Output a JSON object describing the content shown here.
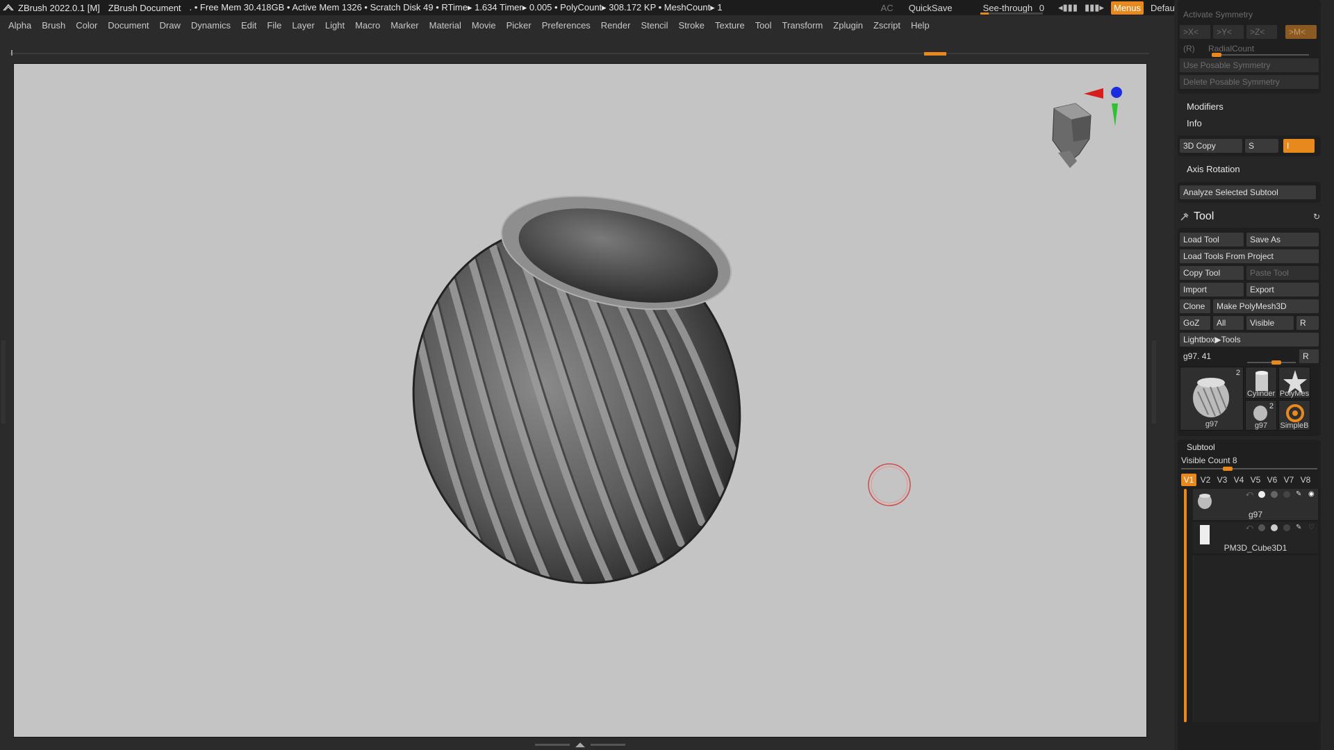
{
  "titlebar": {
    "app": "ZBrush 2022.0.1 [M]",
    "document": "ZBrush Document",
    "stats": ". • Free Mem 30.418GB • Active Mem 1326 • Scratch Disk 49 •  RTime▸ 1.634 Timer▸ 0.005 • PolyCount▸ 308.172 KP  • MeshCount▸ 1",
    "ac": "AC",
    "quicksave": "QuickSave",
    "see_through_label": "See-through",
    "see_through_value": "0",
    "menus": "Menus",
    "script": "DefaultZScript",
    "window_buttons": [
      "–",
      "□",
      "✕"
    ]
  },
  "menubar": [
    "Alpha",
    "Brush",
    "Color",
    "Document",
    "Draw",
    "Dynamics",
    "Edit",
    "File",
    "Layer",
    "Light",
    "Macro",
    "Marker",
    "Material",
    "Movie",
    "Picker",
    "Preferences",
    "Render",
    "Stencil",
    "Stroke",
    "Texture",
    "Tool",
    "Transform",
    "Zplugin",
    "Zscript",
    "Help"
  ],
  "symmetry": {
    "title": "Activate Symmetry",
    "x": ">X<",
    "y": ">Y<",
    "z": ">Z<",
    "m": ">M<",
    "r": "(R)",
    "radial": "RadialCount",
    "use_posable": "Use Posable Symmetry",
    "delete_posable": "Delete Posable Symmetry"
  },
  "geometry_tail": {
    "modifiers": "Modifiers",
    "info": "Info",
    "copy3d": "3D Copy",
    "s": "S",
    "i": "I",
    "axis_rotation": "Axis Rotation",
    "analyze": "Analyze Selected Subtool"
  },
  "tool": {
    "title": "Tool",
    "load_tool": "Load Tool",
    "save_as": "Save As",
    "load_from_project": "Load Tools From Project",
    "copy_tool": "Copy Tool",
    "paste_tool": "Paste Tool",
    "import": "Import",
    "export": "Export",
    "clone": "Clone",
    "make_polymesh": "Make PolyMesh3D",
    "goz": "GoZ",
    "all": "All",
    "visible": "Visible",
    "r": "R",
    "lightbox": "Lightbox▶Tools",
    "current": "g97. 41",
    "r2": "R",
    "thumbs": {
      "main": {
        "label": "g97",
        "count": "2"
      },
      "cylinder": {
        "label": "Cylinder"
      },
      "polymesh": {
        "label": "PolyMes"
      },
      "small": {
        "label": "g97",
        "count": "2"
      },
      "simpleb": {
        "label": "SimpleB"
      }
    }
  },
  "subtool": {
    "title": "Subtool",
    "visible_count_label": "Visible Count",
    "visible_count": "8",
    "tabs": [
      "V1",
      "V2",
      "V3",
      "V4",
      "V5",
      "V6",
      "V7",
      "V8"
    ],
    "items": [
      {
        "name": "g97"
      },
      {
        "name": "PM3D_Cube3D1"
      }
    ]
  },
  "colors": {
    "accent": "#e8891d",
    "viewport": "#c4c4c4",
    "panel": "#262626"
  }
}
